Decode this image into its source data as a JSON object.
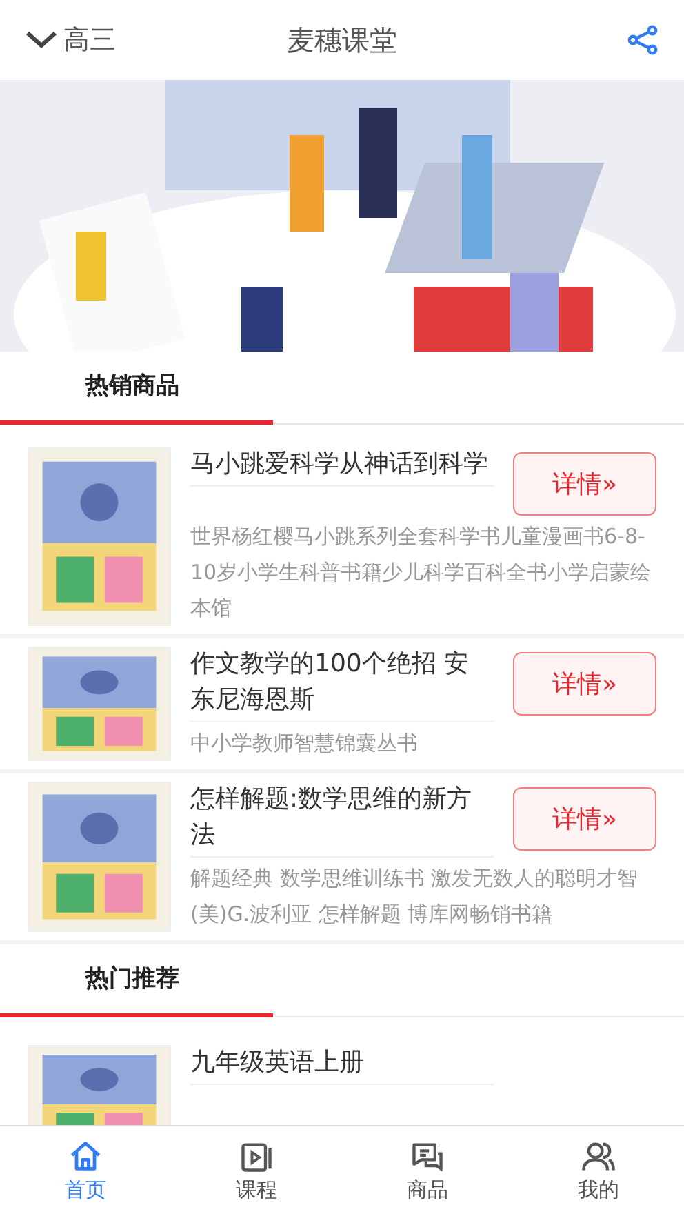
{
  "header": {
    "grade": "高三",
    "title": "麦穗课堂"
  },
  "sections": [
    {
      "title": "热销商品",
      "items": [
        {
          "title": "马小跳爱科学从神话到科学",
          "desc": "世界杨红樱马小跳系列全套科学书儿童漫画书6-8-10岁小学生科普书籍少儿科学百科全书小学启蒙绘本馆",
          "button": "详情»"
        },
        {
          "title": "作文教学的100个绝招 安东尼海恩斯",
          "desc": "中小学教师智慧锦囊丛书",
          "button": "详情»"
        },
        {
          "title": "怎样解题:数学思维的新方法",
          "desc": "解题经典 数学思维训练书 激发无数人的聪明才智 (美)G.波利亚 怎样解题 博库网畅销书籍",
          "button": "详情»"
        }
      ]
    },
    {
      "title": "热门推荐",
      "items": [
        {
          "title": "九年级英语上册"
        }
      ]
    }
  ],
  "tabs": [
    {
      "label": "首页",
      "kind": "home",
      "selected": true
    },
    {
      "label": "课程",
      "kind": "course",
      "selected": false
    },
    {
      "label": "商品",
      "kind": "goods",
      "selected": false
    },
    {
      "label": "我的",
      "kind": "me",
      "selected": false
    }
  ]
}
